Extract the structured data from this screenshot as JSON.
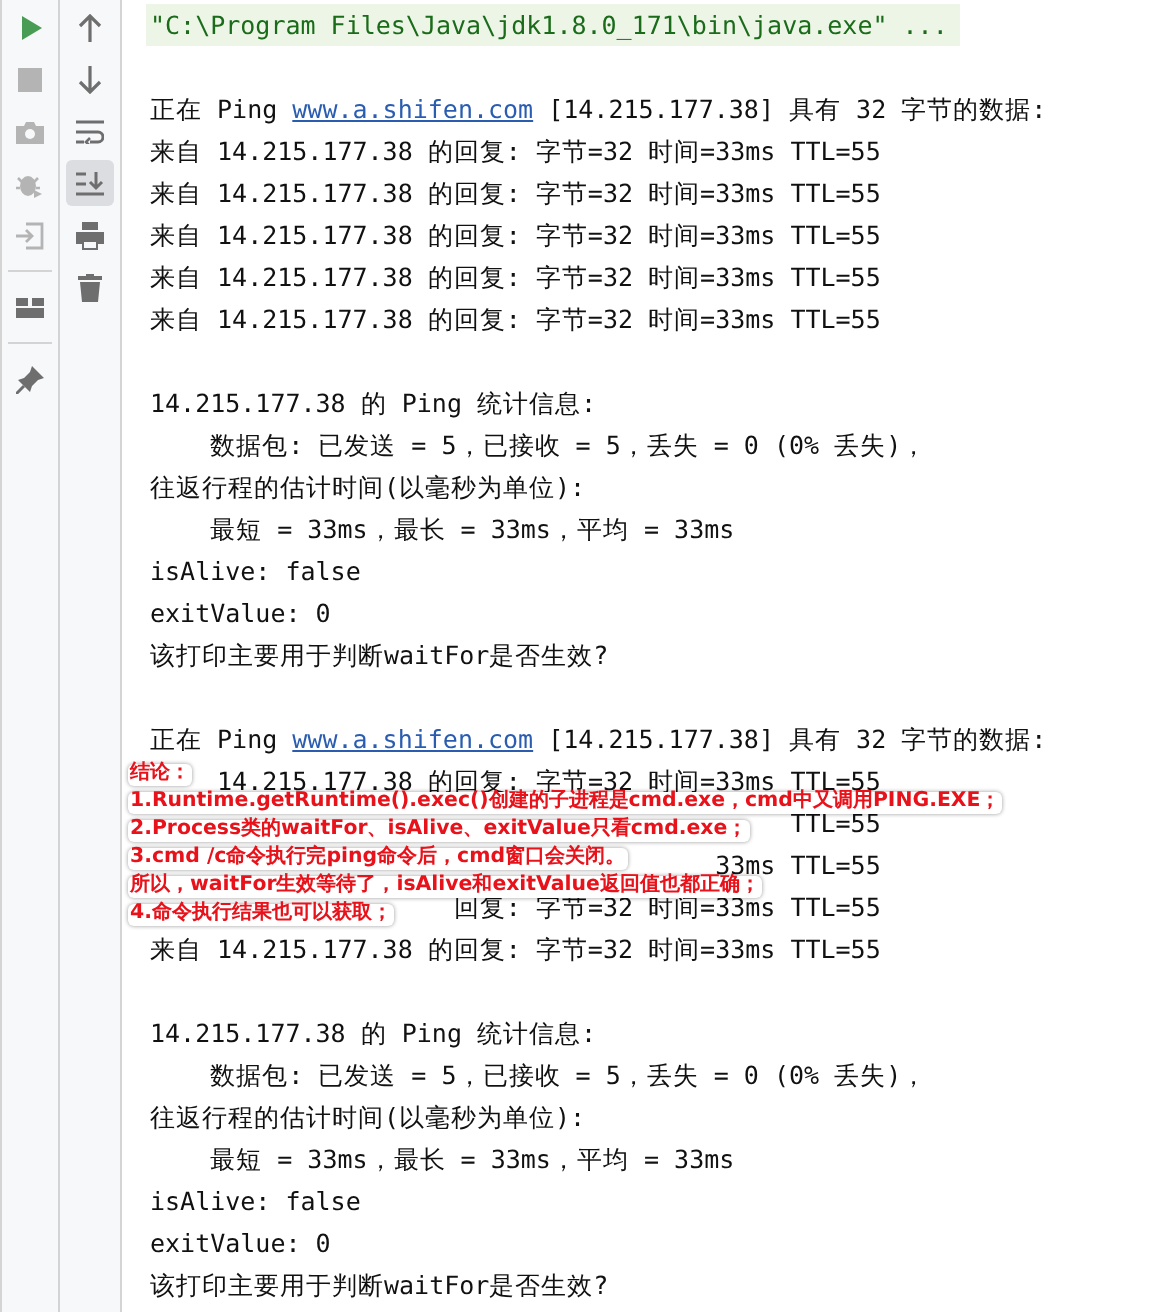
{
  "toolbar_left": [
    {
      "kind": "run",
      "disabled": false
    },
    {
      "kind": "stop",
      "disabled": true
    },
    {
      "kind": "camera",
      "disabled": true
    },
    {
      "kind": "debug",
      "disabled": true
    },
    {
      "kind": "exit",
      "disabled": true
    },
    {
      "kind": "divider"
    },
    {
      "kind": "layout",
      "disabled": false
    },
    {
      "kind": "divider"
    },
    {
      "kind": "pin",
      "disabled": false
    }
  ],
  "toolbar_right": [
    {
      "kind": "up"
    },
    {
      "kind": "down"
    },
    {
      "kind": "wrap",
      "on": false
    },
    {
      "kind": "scroll_end",
      "on": true
    },
    {
      "kind": "print"
    },
    {
      "kind": "trash"
    }
  ],
  "console": [
    {
      "kind": "command",
      "text": "\"C:\\Program Files\\Java\\jdk1.8.0_171\\bin\\java.exe\" ..."
    },
    {
      "kind": "blank"
    },
    {
      "kind": "output",
      "parts": [
        {
          "text": "正在 Ping "
        },
        {
          "text": "www.a.shifen.com",
          "link": true
        },
        {
          "text": " [14.215.177.38] 具有 32 字节的数据:"
        }
      ]
    },
    {
      "kind": "output",
      "parts": [
        {
          "text": "来自 14.215.177.38 的回复: 字节=32 时间=33ms TTL=55"
        }
      ]
    },
    {
      "kind": "output",
      "parts": [
        {
          "text": "来自 14.215.177.38 的回复: 字节=32 时间=33ms TTL=55"
        }
      ]
    },
    {
      "kind": "output",
      "parts": [
        {
          "text": "来自 14.215.177.38 的回复: 字节=32 时间=33ms TTL=55"
        }
      ]
    },
    {
      "kind": "output",
      "parts": [
        {
          "text": "来自 14.215.177.38 的回复: 字节=32 时间=33ms TTL=55"
        }
      ]
    },
    {
      "kind": "output",
      "parts": [
        {
          "text": "来自 14.215.177.38 的回复: 字节=32 时间=33ms TTL=55"
        }
      ]
    },
    {
      "kind": "blank"
    },
    {
      "kind": "output",
      "parts": [
        {
          "text": "14.215.177.38 的 Ping 统计信息:"
        }
      ]
    },
    {
      "kind": "output",
      "parts": [
        {
          "text": "    数据包: 已发送 = 5，已接收 = 5，丢失 = 0 (0% 丢失)，"
        }
      ]
    },
    {
      "kind": "output",
      "parts": [
        {
          "text": "往返行程的估计时间(以毫秒为单位):"
        }
      ]
    },
    {
      "kind": "output",
      "parts": [
        {
          "text": "    最短 = 33ms，最长 = 33ms，平均 = 33ms"
        }
      ]
    },
    {
      "kind": "output",
      "parts": [
        {
          "text": "isAlive: false"
        }
      ]
    },
    {
      "kind": "output",
      "parts": [
        {
          "text": "exitValue: 0"
        }
      ]
    },
    {
      "kind": "output",
      "parts": [
        {
          "text": "该打印主要用于判断waitFor是否生效?"
        }
      ]
    },
    {
      "kind": "blank"
    },
    {
      "kind": "output",
      "parts": [
        {
          "text": "正在 Ping "
        },
        {
          "text": "www.a.shifen.com",
          "link": true
        },
        {
          "text": " [14.215.177.38] 具有 32 字节的数据:"
        }
      ]
    },
    {
      "kind": "covered",
      "lines": [
        "14.215.177.38 的回复: 字节=32 时间=33ms TTL=55",
        "TTL=55",
        "33ms TTL=55",
        "回复: 字节=32 时间=33ms TTL=55",
        "来自 14.215.177.38 的回复: 字节=32 时间=33ms TTL=55"
      ],
      "note": {
        "title": "结论：",
        "lines": [
          "1.Runtime.getRuntime().exec()创建的子进程是cmd.exe，cmd中又调用PING.EXE；",
          "2.Process类的waitFor、isAlive、exitValue只看cmd.exe；",
          "3.cmd /c命令执行完ping命令后，cmd窗口会关闭。",
          "所以，waitFor生效等待了，isAlive和exitValue返回值也都正确；",
          "4.命令执行结果也可以获取；"
        ]
      }
    },
    {
      "kind": "blank"
    },
    {
      "kind": "output",
      "parts": [
        {
          "text": "14.215.177.38 的 Ping 统计信息:"
        }
      ]
    },
    {
      "kind": "output",
      "parts": [
        {
          "text": "    数据包: 已发送 = 5，已接收 = 5，丢失 = 0 (0% 丢失)，"
        }
      ]
    },
    {
      "kind": "output",
      "parts": [
        {
          "text": "往返行程的估计时间(以毫秒为单位):"
        }
      ]
    },
    {
      "kind": "output",
      "parts": [
        {
          "text": "    最短 = 33ms，最长 = 33ms，平均 = 33ms"
        }
      ]
    },
    {
      "kind": "output",
      "parts": [
        {
          "text": "isAlive: false"
        }
      ]
    },
    {
      "kind": "output",
      "parts": [
        {
          "text": "exitValue: 0"
        }
      ]
    },
    {
      "kind": "output",
      "parts": [
        {
          "text": "该打印主要用于判断waitFor是否生效?"
        }
      ]
    }
  ]
}
